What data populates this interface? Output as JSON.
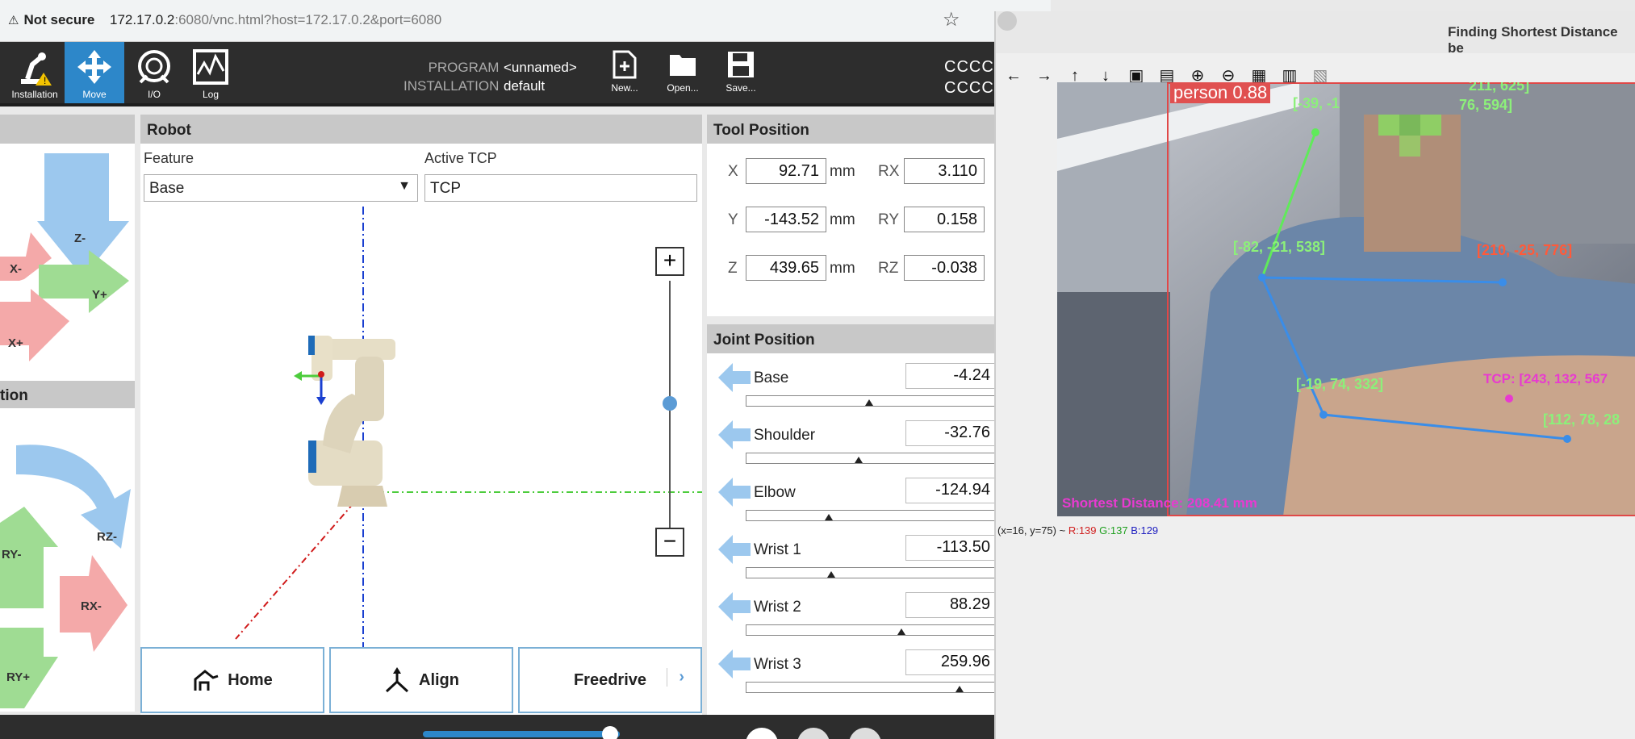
{
  "browser": {
    "security": "Not secure",
    "url_host": "172.17.0.2",
    "url_rest": ":6080/vnc.html?host=172.17.0.2&port=6080"
  },
  "header": {
    "tabs": [
      {
        "label": "Installation"
      },
      {
        "label": "Move"
      },
      {
        "label": "I/O"
      },
      {
        "label": "Log"
      }
    ],
    "program_label": "PROGRAM",
    "program_value": "<unnamed>",
    "installation_label": "INSTALLATION",
    "installation_value": "default",
    "file_buttons": [
      {
        "label": "New..."
      },
      {
        "label": "Open..."
      },
      {
        "label": "Save..."
      }
    ],
    "cccc1": "CCCC",
    "cccc2": "CCCC"
  },
  "move": {
    "labels": [
      "Z-",
      "X-",
      "Y+",
      "X+"
    ],
    "orient_title": "tion",
    "orient_labels": [
      "RZ-",
      "RY-",
      "RX-",
      "RY+"
    ]
  },
  "robot": {
    "title": "Robot",
    "feature_label": "Feature",
    "feature_value": "Base",
    "tcp_label": "Active TCP",
    "tcp_value": "TCP",
    "zoom_in": "+",
    "zoom_out": "−",
    "buttons": {
      "home": "Home",
      "align": "Align",
      "freedrive": "Freedrive"
    }
  },
  "tool": {
    "title": "Tool Position",
    "rows": [
      {
        "axis": "X",
        "value": "92.71",
        "unit": "mm",
        "raxis": "RX",
        "rvalue": "3.110"
      },
      {
        "axis": "Y",
        "value": "-143.52",
        "unit": "mm",
        "raxis": "RY",
        "rvalue": "0.158"
      },
      {
        "axis": "Z",
        "value": "439.65",
        "unit": "mm",
        "raxis": "RZ",
        "rvalue": "-0.038"
      }
    ]
  },
  "joint": {
    "title": "Joint Position",
    "rows": [
      {
        "name": "Base",
        "value": "-4.24",
        "level": 0.49
      },
      {
        "name": "Shoulder",
        "value": "-32.76",
        "level": 0.45
      },
      {
        "name": "Elbow",
        "value": "-124.94",
        "level": 0.33
      },
      {
        "name": "Wrist 1",
        "value": "-113.50",
        "level": 0.34
      },
      {
        "name": "Wrist 2",
        "value": "88.29",
        "level": 0.62
      },
      {
        "name": "Wrist 3",
        "value": "259.96",
        "level": 0.85
      }
    ]
  },
  "viewer": {
    "title": "Finding Shortest Distance be",
    "detection": "person 0.88",
    "points": {
      "p1": "[-39, -1",
      "p1b": "76, 594]",
      "p_top": "211, 625]",
      "p2": "[-82, -21, 538]",
      "p3": "[210, -25, 776]",
      "p4": "[-19, 74, 332]",
      "p5": "[112, 78, 28",
      "tcp": "TCP: [243, 132, 567"
    },
    "shortest": "Shortest Distance: 208.41 mm",
    "status_pos": "(x=16, y=75) ~ ",
    "r": "R:139",
    "g": "G:137",
    "b": "B:129"
  }
}
